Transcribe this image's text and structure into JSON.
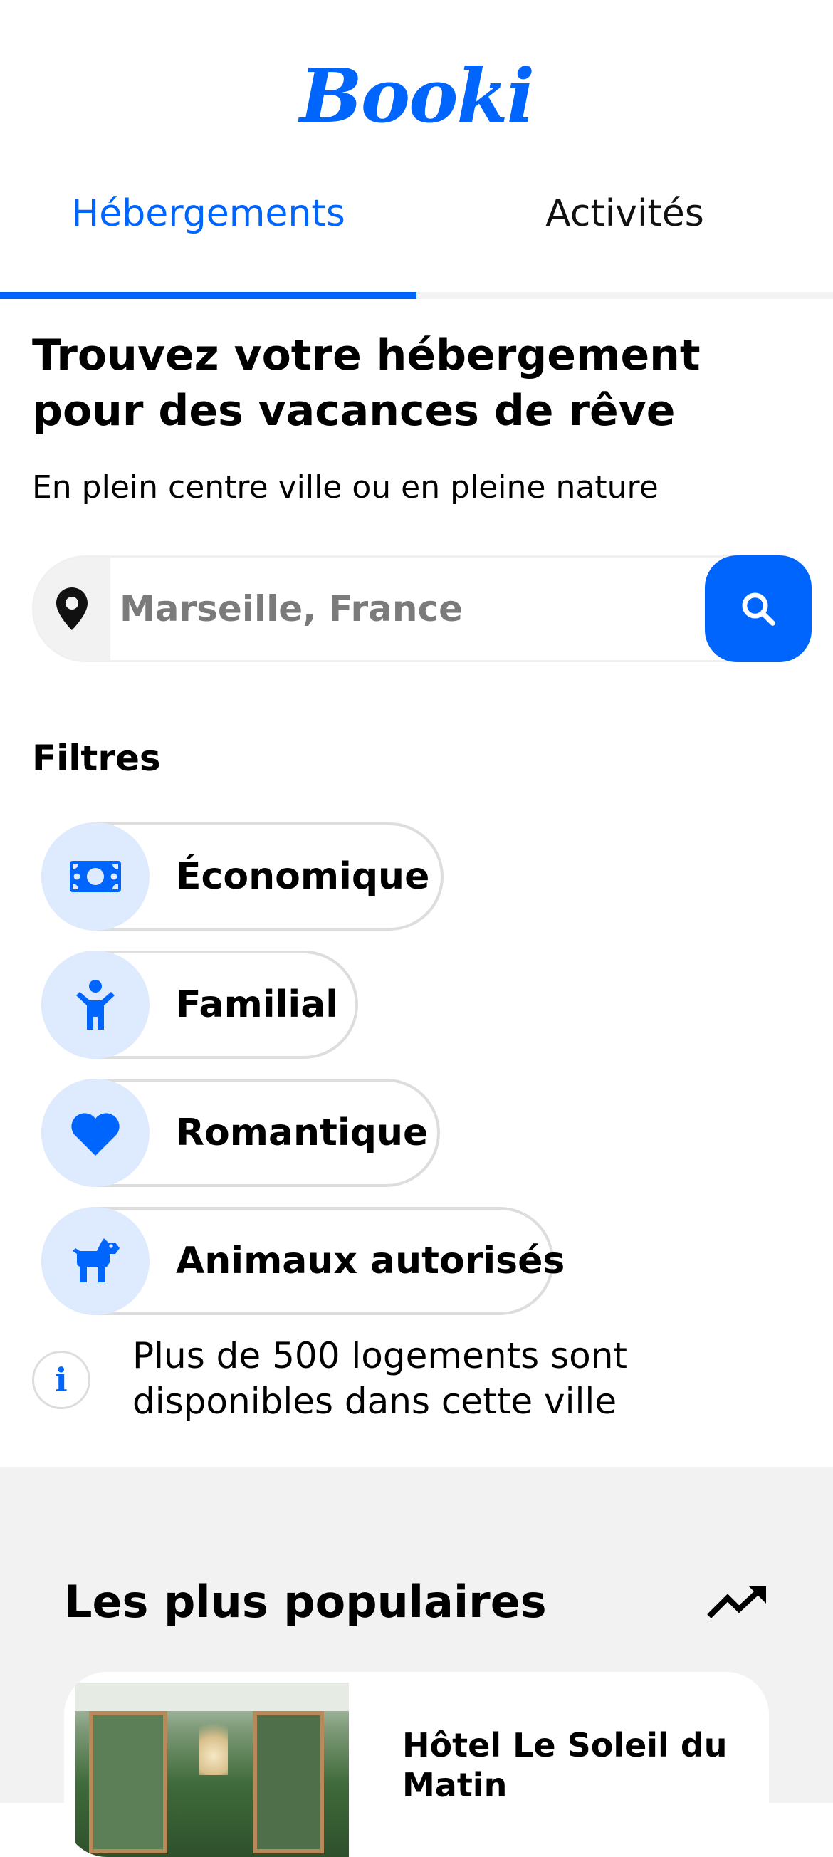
{
  "app": {
    "logo": "Booki"
  },
  "tabs": [
    {
      "label": "Hébergements",
      "active": true
    },
    {
      "label": "Activités",
      "active": false
    }
  ],
  "hero": {
    "title": "Trouvez votre hébergement pour des vacances de rêve",
    "subtitle": "En plein centre ville ou en pleine nature"
  },
  "search": {
    "placeholder": "Marseille, France",
    "location_icon": "location-pin-icon",
    "button_icon": "search-icon"
  },
  "filters": {
    "title": "Filtres",
    "items": [
      {
        "label": "Économique",
        "icon": "money-icon"
      },
      {
        "label": "Familial",
        "icon": "child-icon"
      },
      {
        "label": "Romantique",
        "icon": "heart-icon"
      },
      {
        "label": "Animaux autorisés",
        "icon": "dog-icon"
      }
    ]
  },
  "info": {
    "icon_glyph": "i",
    "text": "Plus de 500 logements sont disponibles dans cette ville"
  },
  "popular": {
    "title": "Les plus populaires",
    "icon": "trending-up-icon",
    "cards": [
      {
        "title": "Hôtel Le Soleil du Matin"
      }
    ]
  },
  "colors": {
    "accent": "#0065fc",
    "chip_icon_bg": "#deebff",
    "section_bg": "#f2f2f2"
  }
}
